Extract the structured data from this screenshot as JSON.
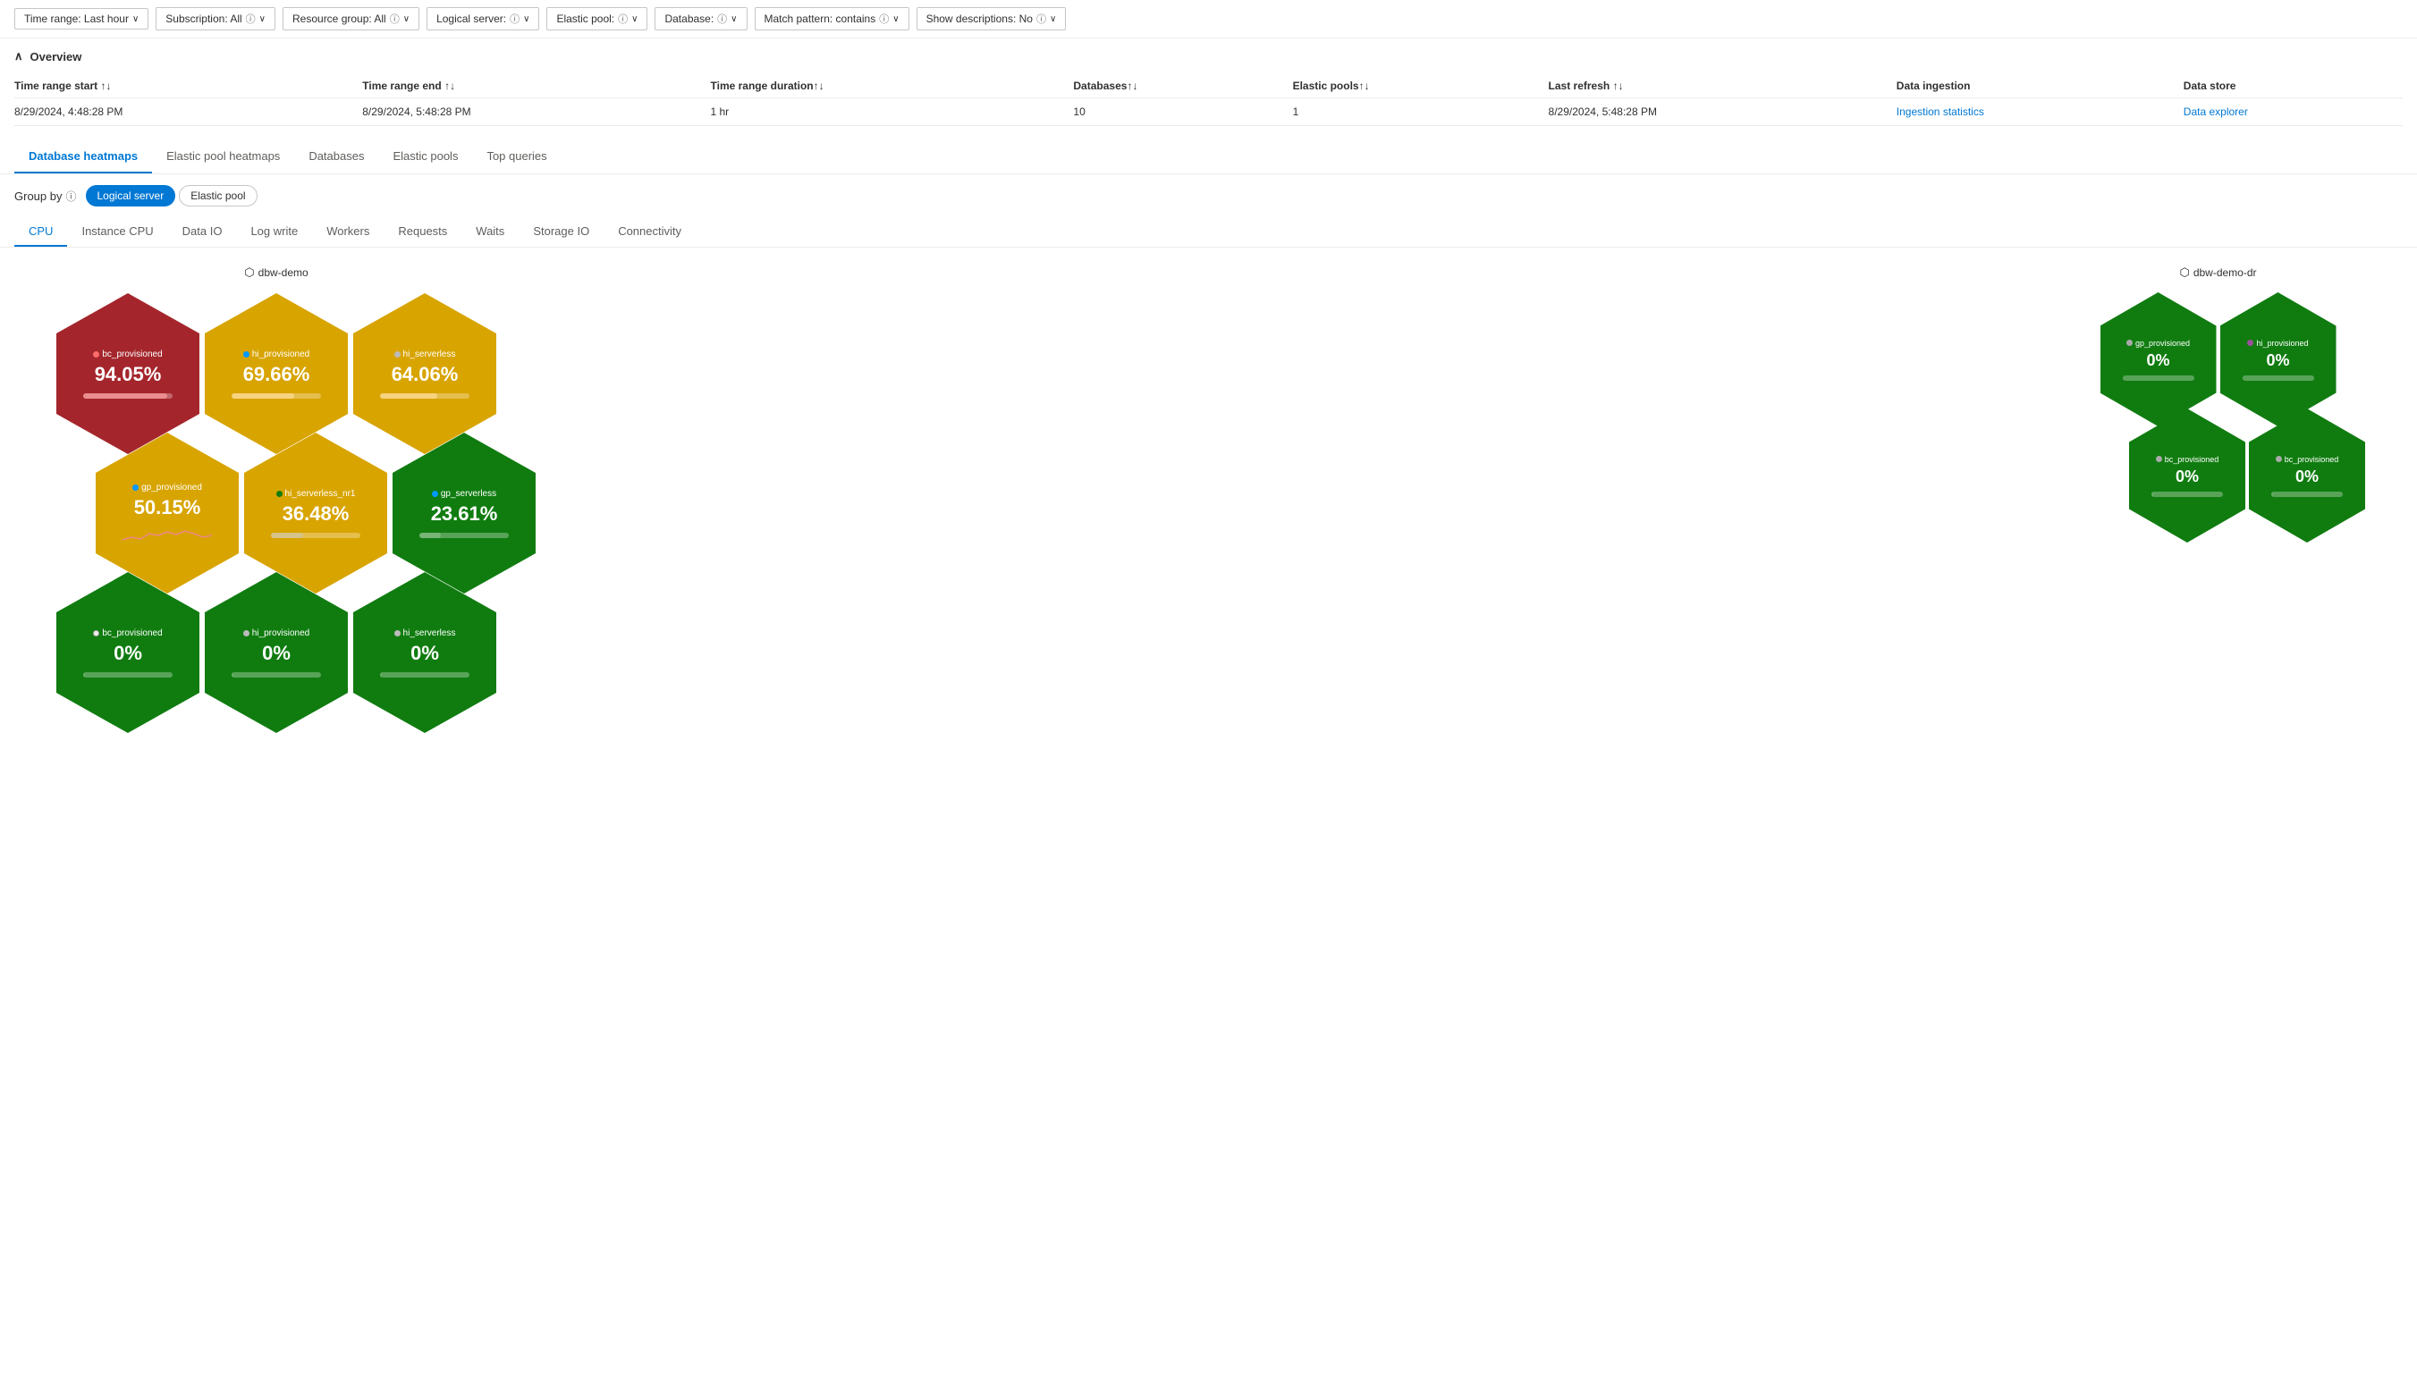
{
  "filters": [
    {
      "label": "Time range: Last hour",
      "name": "time-range-filter",
      "hasInfo": false
    },
    {
      "label": "Subscription: All",
      "name": "subscription-filter",
      "hasInfo": true
    },
    {
      "label": "Resource group: All",
      "name": "resource-group-filter",
      "hasInfo": true
    },
    {
      "label": "Logical server: <unset>",
      "name": "logical-server-filter",
      "hasInfo": true
    },
    {
      "label": "Elastic pool: <unset>",
      "name": "elastic-pool-filter",
      "hasInfo": true
    },
    {
      "label": "Database: <unset>",
      "name": "database-filter",
      "hasInfo": true
    },
    {
      "label": "Match pattern: contains",
      "name": "match-pattern-filter",
      "hasInfo": true
    },
    {
      "label": "Show descriptions: No",
      "name": "show-descriptions-filter",
      "hasInfo": true
    }
  ],
  "overview": {
    "title": "Overview",
    "table": {
      "columns": [
        {
          "label": "Time range start",
          "sortable": true
        },
        {
          "label": "Time range end",
          "sortable": true
        },
        {
          "label": "Time range duration",
          "sortable": true
        },
        {
          "label": "Databases",
          "sortable": true
        },
        {
          "label": "Elastic pools",
          "sortable": true
        },
        {
          "label": "Last refresh",
          "sortable": true
        },
        {
          "label": "Data ingestion",
          "sortable": false
        },
        {
          "label": "Data store",
          "sortable": false
        }
      ],
      "rows": [
        {
          "time_start": "8/29/2024, 4:48:28 PM",
          "time_end": "8/29/2024, 5:48:28 PM",
          "duration": "1 hr",
          "databases": "10",
          "elastic_pools": "1",
          "last_refresh": "8/29/2024, 5:48:28 PM",
          "data_ingestion_link": "Ingestion statistics",
          "data_store_link": "Data explorer"
        }
      ]
    }
  },
  "main_tabs": [
    {
      "label": "Database heatmaps",
      "active": true
    },
    {
      "label": "Elastic pool heatmaps",
      "active": false
    },
    {
      "label": "Databases",
      "active": false
    },
    {
      "label": "Elastic pools",
      "active": false
    },
    {
      "label": "Top queries",
      "active": false
    }
  ],
  "group_by": {
    "label": "Group by",
    "options": [
      {
        "label": "Logical server",
        "active": true
      },
      {
        "label": "Elastic pool",
        "active": false
      }
    ]
  },
  "sub_tabs": [
    {
      "label": "CPU",
      "active": true
    },
    {
      "label": "Instance CPU",
      "active": false
    },
    {
      "label": "Data IO",
      "active": false
    },
    {
      "label": "Log write",
      "active": false
    },
    {
      "label": "Workers",
      "active": false
    },
    {
      "label": "Requests",
      "active": false
    },
    {
      "label": "Waits",
      "active": false
    },
    {
      "label": "Storage IO",
      "active": false
    },
    {
      "label": "Connectivity",
      "active": false
    }
  ],
  "clusters": [
    {
      "name": "dbw-demo",
      "hexagons": [
        {
          "row": 0,
          "cells": [
            {
              "label": "bc_provisioned",
              "value": "94.05%",
              "color": "red",
              "dot_color": "#e00",
              "bar_pct": 94,
              "bar_color": "rgba(255,120,120,0.7)",
              "has_bar": true,
              "has_sparkline": false
            },
            {
              "label": "hi_provisioned",
              "value": "69.66%",
              "color": "yellow",
              "dot_color": "#0099ff",
              "bar_pct": 70,
              "bar_color": "rgba(255,220,150,0.7)",
              "has_bar": true,
              "has_sparkline": false
            },
            {
              "label": "hi_serverless",
              "value": "64.06%",
              "color": "yellow",
              "dot_color": "#aaa",
              "bar_pct": 64,
              "bar_color": "rgba(255,220,150,0.7)",
              "has_bar": true,
              "has_sparkline": false
            }
          ]
        },
        {
          "row": 1,
          "offset": true,
          "cells": [
            {
              "label": "gp_provisioned",
              "value": "50.15%",
              "color": "yellow",
              "dot_color": "#0099ff",
              "bar_pct": 50,
              "bar_color": null,
              "has_bar": false,
              "has_sparkline": true,
              "sparkline_color": "#e88"
            },
            {
              "label": "hi_serverless_nr1",
              "value": "36.48%",
              "color": "yellow",
              "dot_color": "#107c10",
              "bar_pct": 36,
              "bar_color": "rgba(200,200,200,0.5)",
              "has_bar": true,
              "has_sparkline": false
            },
            {
              "label": "gp_serverless",
              "value": "23.61%",
              "color": "green",
              "dot_color": "#0099ff",
              "bar_pct": 24,
              "bar_color": "rgba(150,200,150,0.5)",
              "has_bar": true,
              "has_sparkline": false
            }
          ]
        },
        {
          "row": 2,
          "cells": [
            {
              "label": "bc_provisioned",
              "value": "0%",
              "color": "green",
              "dot_color": "#fff",
              "bar_pct": 0,
              "bar_color": "rgba(150,200,150,0.3)",
              "has_bar": true,
              "has_sparkline": false
            },
            {
              "label": "hi_provisioned",
              "value": "0%",
              "color": "green",
              "dot_color": "#aaa",
              "bar_pct": 0,
              "bar_color": "rgba(150,200,150,0.3)",
              "has_bar": true,
              "has_sparkline": false
            },
            {
              "label": "hi_serverless",
              "value": "0%",
              "color": "green",
              "dot_color": "#aaa",
              "bar_pct": 0,
              "bar_color": "rgba(150,200,150,0.3)",
              "has_bar": true,
              "has_sparkline": false
            }
          ]
        }
      ]
    },
    {
      "name": "dbw-demo-dr",
      "small": true,
      "hexagons": [
        {
          "row": 0,
          "cells": [
            {
              "label": "gp_provisioned",
              "value": "0%",
              "color": "green",
              "dot_color": "#aaa",
              "bar_pct": 0
            },
            {
              "label": "hi_provisioned",
              "value": "0%",
              "color": "green",
              "dot_color": "#9b4f9b",
              "bar_pct": 0
            }
          ]
        },
        {
          "row": 1,
          "offset": true,
          "cells": [
            {
              "label": "bc_provisioned",
              "value": "0%",
              "color": "green",
              "dot_color": "#aaa",
              "bar_pct": 0
            },
            {
              "label": "bc_provisioned",
              "value": "0%",
              "color": "green",
              "dot_color": "#aaa",
              "bar_pct": 0
            }
          ]
        }
      ]
    }
  ],
  "icons": {
    "server": "⬡",
    "info": "ⓘ",
    "chevron_down": "∨",
    "chevron_up": "∧",
    "sort": "↑↓"
  }
}
